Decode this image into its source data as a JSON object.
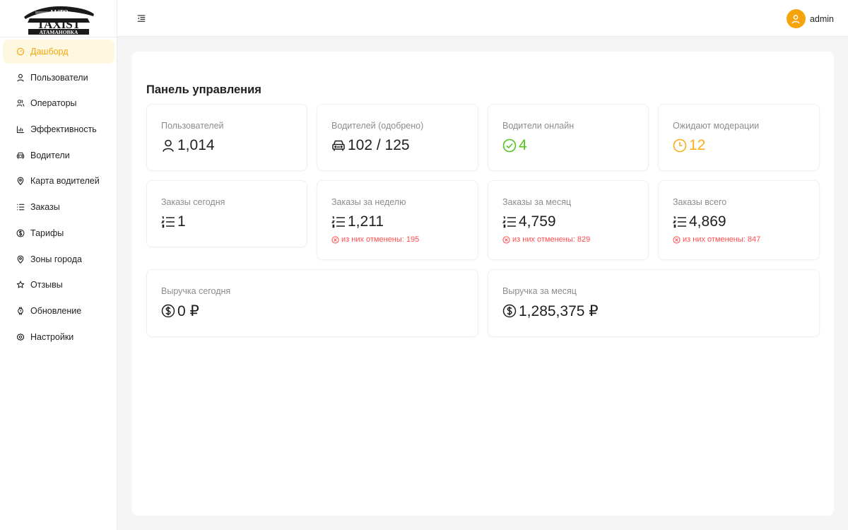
{
  "brand": {
    "logo_top": "AUTO",
    "logo_main": "TAXIST",
    "logo_bottom": "АТАМАНОВКА",
    "accent_color": "#f5a50b"
  },
  "sidebar": {
    "items": [
      {
        "label": "Дашборд",
        "icon": "dashboard-icon",
        "active": true
      },
      {
        "label": "Пользователи",
        "icon": "user-icon"
      },
      {
        "label": "Операторы",
        "icon": "team-icon"
      },
      {
        "label": "Эффективность",
        "icon": "bar-chart-icon"
      },
      {
        "label": "Водители",
        "icon": "car-icon"
      },
      {
        "label": "Карта водителей",
        "icon": "map-pin-icon"
      },
      {
        "label": "Заказы",
        "icon": "list-icon"
      },
      {
        "label": "Тарифы",
        "icon": "dollar-icon"
      },
      {
        "label": "Зоны города",
        "icon": "location-icon"
      },
      {
        "label": "Отзывы",
        "icon": "star-icon"
      },
      {
        "label": "Обновление",
        "icon": "watch-icon"
      },
      {
        "label": "Настройки",
        "icon": "gear-icon"
      }
    ]
  },
  "header": {
    "username": "admin"
  },
  "page": {
    "title": "Панель управления"
  },
  "stats": {
    "users": {
      "label": "Пользователей",
      "value": "1,014"
    },
    "drivers_approved": {
      "label": "Водителей (одобрено)",
      "value": "102 / 125"
    },
    "drivers_online": {
      "label": "Водители онлайн",
      "value": "4",
      "color": "#52c41a"
    },
    "pending_moderation": {
      "label": "Ожидают модерации",
      "value": "12",
      "color": "#faad14"
    },
    "orders_today": {
      "label": "Заказы сегодня",
      "value": "1"
    },
    "orders_week": {
      "label": "Заказы за неделю",
      "value": "1,211",
      "cancelled": "из них отменены: 195"
    },
    "orders_month": {
      "label": "Заказы за месяц",
      "value": "4,759",
      "cancelled": "из них отменены: 829"
    },
    "orders_total": {
      "label": "Заказы всего",
      "value": "4,869",
      "cancelled": "из них отменены: 847"
    },
    "revenue_today": {
      "label": "Выручка сегодня",
      "value": "0 ₽"
    },
    "revenue_month": {
      "label": "Выручка за месяц",
      "value": "1,285,375 ₽"
    }
  }
}
